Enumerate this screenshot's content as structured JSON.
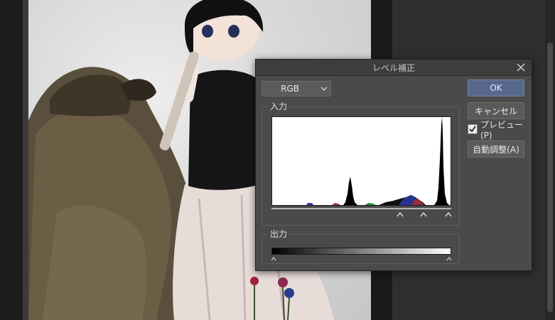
{
  "dialog": {
    "title": "レベル補正",
    "channel_select": {
      "value": "RGB"
    },
    "input_group_label": "入力",
    "output_group_label": "出力",
    "buttons": {
      "ok": "OK",
      "cancel": "キャンセル",
      "auto": "自動調整(A)"
    },
    "preview": {
      "label": "プレビュー(P)",
      "checked": true
    }
  },
  "icons": [
    "close-icon",
    "chevron-down-icon",
    "checkmark-icon",
    "slider-handle-icon"
  ],
  "colors": {
    "ok_button": "#56688c",
    "dialog_bg": "#4a4a4a",
    "histogram_bg": "#ffffff"
  }
}
